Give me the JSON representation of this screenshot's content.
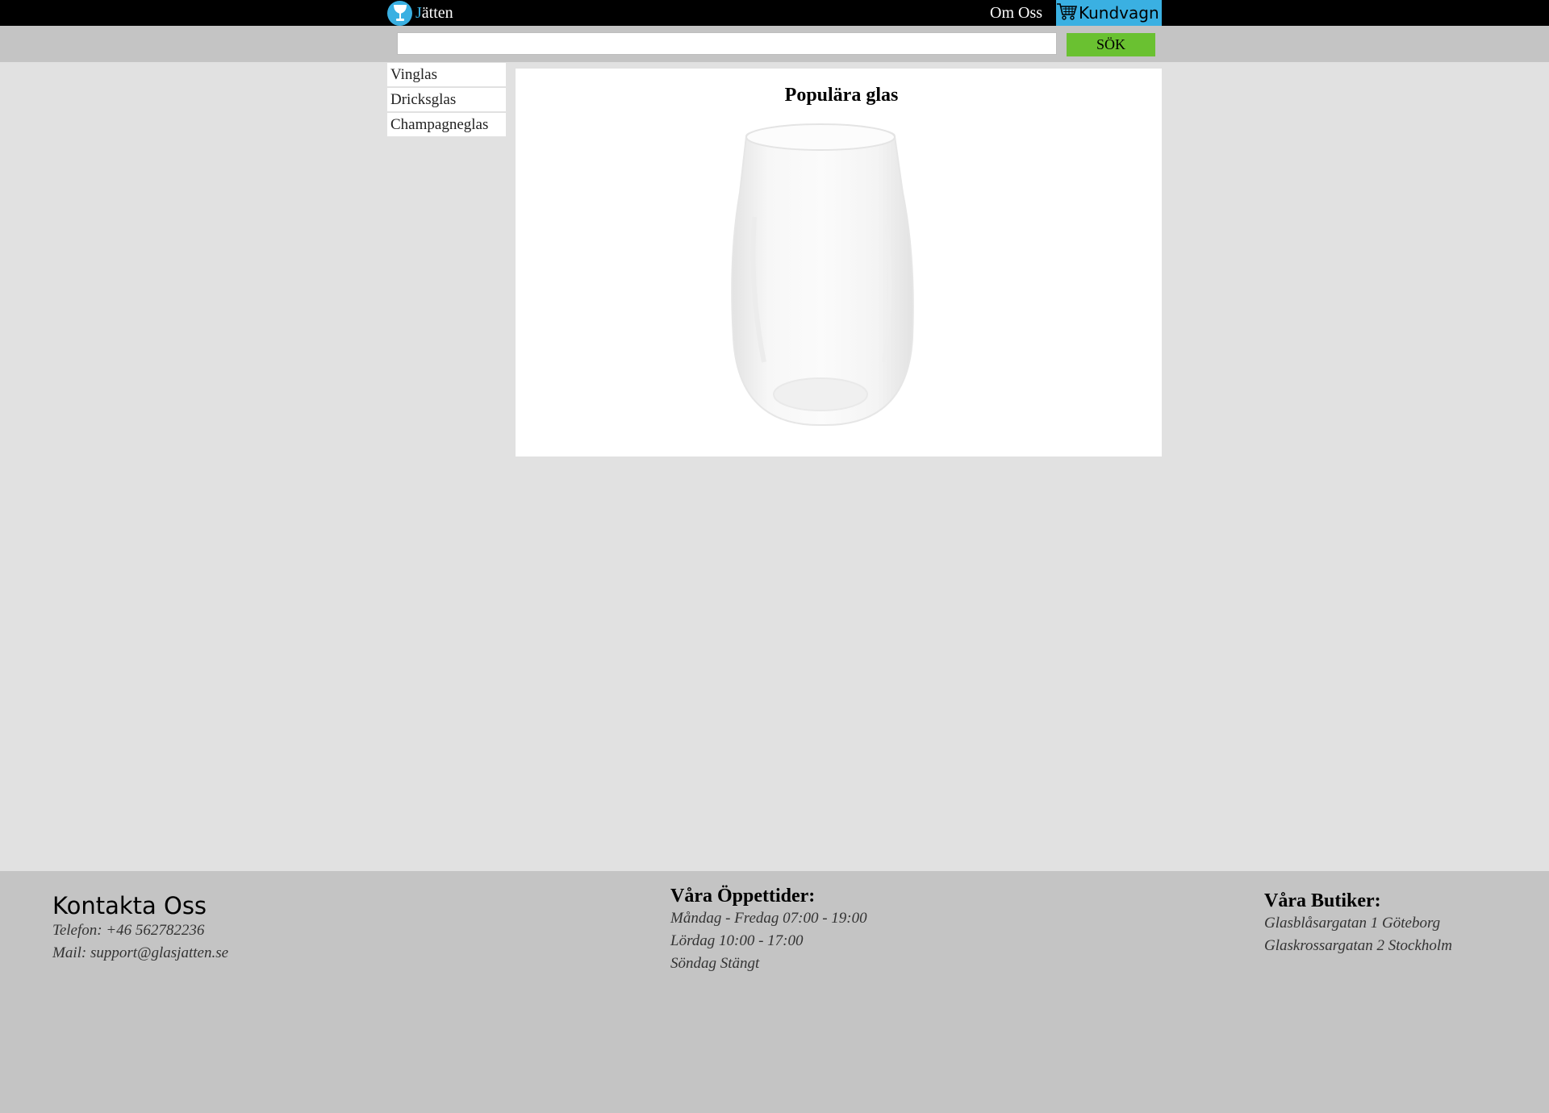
{
  "header": {
    "brand_first": "J",
    "brand_rest": "ätten",
    "about_label": "Om Oss",
    "cart_label": "Kundvagn"
  },
  "search": {
    "value": "",
    "placeholder": "",
    "button_label": "SÖK"
  },
  "sidebar": {
    "items": [
      {
        "label": "Vinglas"
      },
      {
        "label": "Dricksglas"
      },
      {
        "label": "Champagneglas"
      }
    ]
  },
  "main": {
    "title": "Populära glas"
  },
  "footer": {
    "contact": {
      "heading": "Kontakta Oss",
      "lines": [
        "Telefon: +46 562782236",
        "Mail: support@glasjatten.se"
      ]
    },
    "hours": {
      "heading": "Våra Öppettider:",
      "lines": [
        "Måndag - Fredag 07:00 - 19:00",
        "Lördag 10:00 - 17:00",
        "Söndag Stängt"
      ]
    },
    "stores": {
      "heading": "Våra Butiker:",
      "lines": [
        "Glasblåsargatan 1 Göteborg",
        "Glaskrossargatan 2 Stockholm"
      ]
    }
  },
  "colors": {
    "accent": "#3ab0e2",
    "search_button": "#6ac131",
    "topbar": "#000000",
    "band": "#c4c4c4",
    "page_bg": "#e1e1e1"
  },
  "icons": {
    "logo": "wine-glass-icon",
    "cart": "shopping-cart-icon"
  }
}
